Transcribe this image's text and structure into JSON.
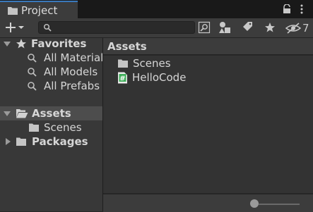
{
  "window": {
    "tab_label": "Project",
    "lock_icon": "lock-icon",
    "menu_icon": "kebab-menu-icon"
  },
  "toolbar": {
    "create_icon": "plus-icon",
    "search": {
      "value": "",
      "placeholder": ""
    },
    "buttons": [
      "search-by-type-icon",
      "label-icon",
      "star-icon"
    ],
    "hidden_packages_count": "7"
  },
  "tree": {
    "favorites": {
      "label": "Favorites",
      "items": [
        "All Material",
        "All Models",
        "All Prefabs"
      ]
    },
    "assets": {
      "label": "Assets",
      "children": [
        "Scenes"
      ]
    },
    "packages": {
      "label": "Packages"
    }
  },
  "main": {
    "breadcrumb": "Assets",
    "items": [
      {
        "name": "Scenes",
        "icon": "folder-icon"
      },
      {
        "name": "HelloCode",
        "icon": "csharp-script-icon"
      }
    ],
    "zoom": 0.0
  },
  "colors": {
    "accent": "#3a79bb",
    "script_icon": "#3fae5a"
  }
}
